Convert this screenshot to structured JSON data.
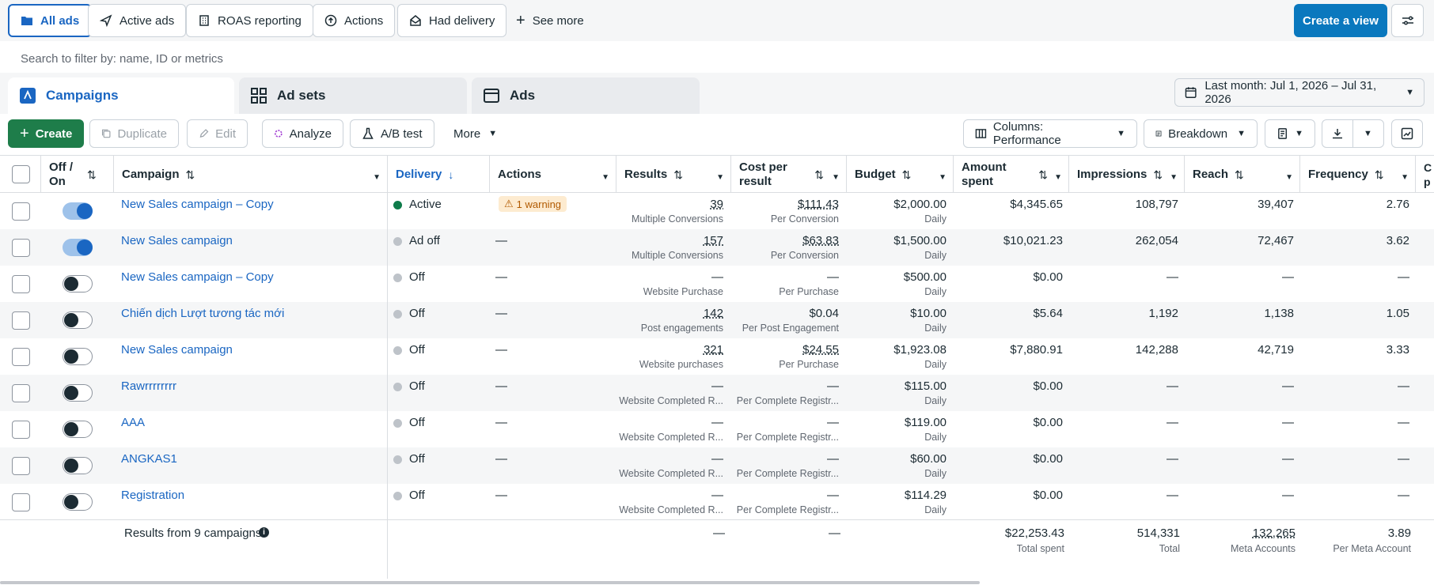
{
  "views": {
    "all_ads": "All ads",
    "active_ads": "Active ads",
    "roas": "ROAS reporting",
    "actions": "Actions",
    "had_delivery": "Had delivery",
    "see_more": "See more",
    "create_view": "Create a view"
  },
  "search": {
    "placeholder": "Search to filter by: name, ID or metrics"
  },
  "tabs": {
    "campaigns": "Campaigns",
    "ad_sets": "Ad sets",
    "ads": "Ads"
  },
  "date_range": "Last month: Jul 1, 2026 – Jul 31, 2026",
  "toolbar": {
    "create": "Create",
    "duplicate": "Duplicate",
    "edit": "Edit",
    "analyze": "Analyze",
    "ab_test": "A/B test",
    "more": "More",
    "columns": "Columns: Performance",
    "breakdown": "Breakdown"
  },
  "columns": {
    "off_on": "Off /\nOn",
    "campaign": "Campaign",
    "delivery": "Delivery",
    "actions": "Actions",
    "results": "Results",
    "cost_per_result": "Cost per\nresult",
    "budget": "Budget",
    "amount_spent": "Amount\nspent",
    "impressions": "Impressions",
    "reach": "Reach",
    "frequency": "Frequency"
  },
  "rows": [
    {
      "name": "New Sales campaign – Copy",
      "on": true,
      "delivery": "Active",
      "actions": "1 warning",
      "results": "39",
      "results_sub": "Multiple Conversions",
      "cpr": "$111.43",
      "cpr_sub": "Per Conversion",
      "budget": "$2,000.00",
      "budget_sub": "Daily",
      "spent": "$4,345.65",
      "impressions": "108,797",
      "reach": "39,407",
      "frequency": "2.76"
    },
    {
      "name": "New Sales campaign",
      "on": true,
      "delivery": "Ad off",
      "actions": "—",
      "results": "157",
      "results_sub": "Multiple Conversions",
      "cpr": "$63.83",
      "cpr_sub": "Per Conversion",
      "budget": "$1,500.00",
      "budget_sub": "Daily",
      "spent": "$10,021.23",
      "impressions": "262,054",
      "reach": "72,467",
      "frequency": "3.62"
    },
    {
      "name": "New Sales campaign – Copy",
      "on": false,
      "delivery": "Off",
      "actions": "—",
      "results": "—",
      "results_sub": "Website Purchase",
      "cpr": "—",
      "cpr_sub": "Per Purchase",
      "budget": "$500.00",
      "budget_sub": "Daily",
      "spent": "$0.00",
      "impressions": "—",
      "reach": "—",
      "frequency": "—"
    },
    {
      "name": "Chiến dịch Lượt tương tác mới",
      "on": false,
      "delivery": "Off",
      "actions": "—",
      "results": "142",
      "results_sub": "Post engagements",
      "cpr": "$0.04",
      "cpr_sub": "Per Post Engagement",
      "budget": "$10.00",
      "budget_sub": "Daily",
      "spent": "$5.64",
      "impressions": "1,192",
      "reach": "1,138",
      "frequency": "1.05"
    },
    {
      "name": "New Sales campaign",
      "on": false,
      "delivery": "Off",
      "actions": "—",
      "results": "321",
      "results_sub": "Website purchases",
      "cpr": "$24.55",
      "cpr_sub": "Per Purchase",
      "budget": "$1,923.08",
      "budget_sub": "Daily",
      "spent": "$7,880.91",
      "impressions": "142,288",
      "reach": "42,719",
      "frequency": "3.33"
    },
    {
      "name": "Rawrrrrrrrr",
      "on": false,
      "delivery": "Off",
      "actions": "—",
      "results": "—",
      "results_sub": "Website Completed R...",
      "cpr": "—",
      "cpr_sub": "Per Complete Registr...",
      "budget": "$115.00",
      "budget_sub": "Daily",
      "spent": "$0.00",
      "impressions": "—",
      "reach": "—",
      "frequency": "—"
    },
    {
      "name": "AAA",
      "on": false,
      "delivery": "Off",
      "actions": "—",
      "results": "—",
      "results_sub": "Website Completed R...",
      "cpr": "—",
      "cpr_sub": "Per Complete Registr...",
      "budget": "$119.00",
      "budget_sub": "Daily",
      "spent": "$0.00",
      "impressions": "—",
      "reach": "—",
      "frequency": "—"
    },
    {
      "name": "ANGKAS1",
      "on": false,
      "delivery": "Off",
      "actions": "—",
      "results": "—",
      "results_sub": "Website Completed R...",
      "cpr": "—",
      "cpr_sub": "Per Complete Registr...",
      "budget": "$60.00",
      "budget_sub": "Daily",
      "spent": "$0.00",
      "impressions": "—",
      "reach": "—",
      "frequency": "—"
    },
    {
      "name": "Registration",
      "on": false,
      "delivery": "Off",
      "actions": "—",
      "results": "—",
      "results_sub": "Website Completed R...",
      "cpr": "—",
      "cpr_sub": "Per Complete Registr...",
      "budget": "$114.29",
      "budget_sub": "Daily",
      "spent": "$0.00",
      "impressions": "—",
      "reach": "—",
      "frequency": "—"
    }
  ],
  "footer": {
    "label": "Results from 9 campaigns",
    "results": "—",
    "cpr": "—",
    "spent": "$22,253.43",
    "spent_sub": "Total spent",
    "impressions": "514,331",
    "impressions_sub": "Total",
    "reach": "132,265",
    "reach_sub": "Meta Accounts",
    "frequency": "3.89",
    "frequency_sub": "Per Meta Account"
  },
  "colors": {
    "accent": "#1a66c2",
    "create_green": "#1e7d4a",
    "create_view_blue": "#0a78be",
    "active_dot": "#0e7b4a"
  }
}
